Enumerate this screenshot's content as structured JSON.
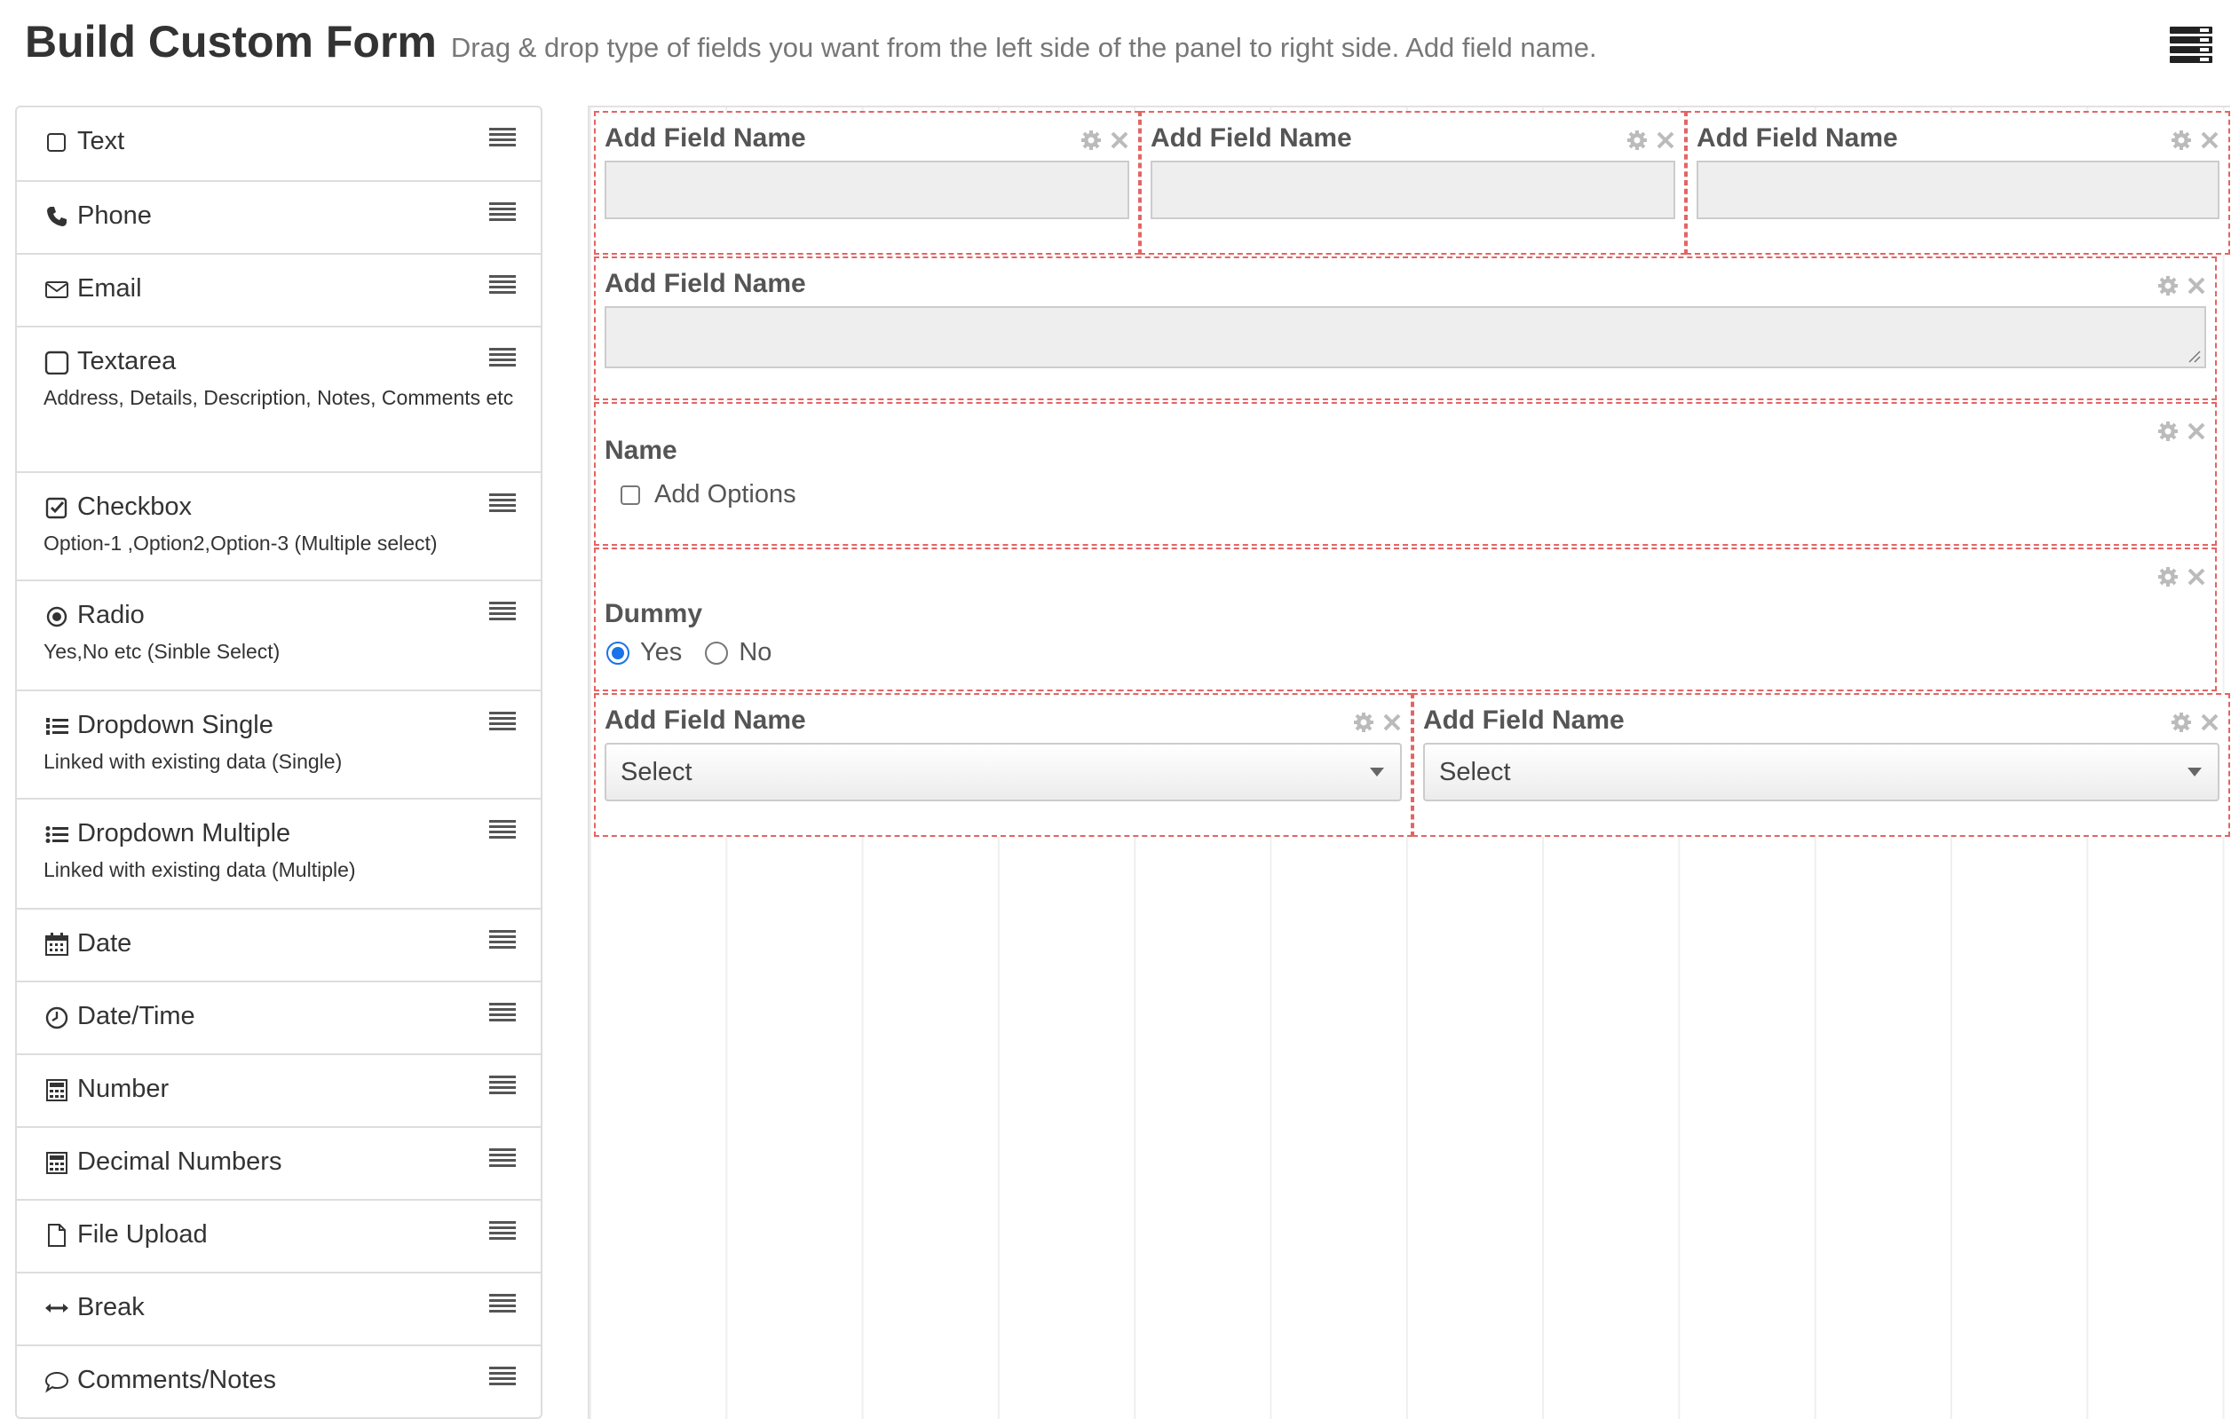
{
  "header": {
    "title": "Build Custom Form",
    "subtitle": "Drag & drop type of fields you want from the left side of the panel to right side. Add field name."
  },
  "palette": {
    "items": [
      {
        "label": "Text",
        "icon": "checkbox-empty-icon",
        "desc": ""
      },
      {
        "label": "Phone",
        "icon": "phone-icon",
        "desc": ""
      },
      {
        "label": "Email",
        "icon": "envelope-icon",
        "desc": ""
      },
      {
        "label": "Textarea",
        "icon": "square-icon",
        "desc": "Address, Details, Description, Notes, Comments etc"
      },
      {
        "label": "Checkbox",
        "icon": "checkbox-checked-icon",
        "desc": "Option-1 ,Option2,Option-3 (Multiple select)"
      },
      {
        "label": "Radio",
        "icon": "radio-icon",
        "desc": "Yes,No etc (Sinble Select)"
      },
      {
        "label": "Dropdown Single",
        "icon": "numbered-list-icon",
        "desc": "Linked with existing data (Single)"
      },
      {
        "label": "Dropdown Multiple",
        "icon": "list-icon",
        "desc": "Linked with existing data (Multiple)"
      },
      {
        "label": "Date",
        "icon": "calendar-icon",
        "desc": ""
      },
      {
        "label": "Date/Time",
        "icon": "clock-icon",
        "desc": ""
      },
      {
        "label": "Number",
        "icon": "calculator-icon",
        "desc": ""
      },
      {
        "label": "Decimal Numbers",
        "icon": "calculator-icon",
        "desc": ""
      },
      {
        "label": "File Upload",
        "icon": "file-icon",
        "desc": ""
      },
      {
        "label": "Break",
        "icon": "horizontal-arrows-icon",
        "desc": ""
      },
      {
        "label": "Comments/Notes",
        "icon": "comment-icon",
        "desc": ""
      }
    ]
  },
  "canvas": {
    "row1": [
      "Add Field Name",
      "Add Field Name",
      "Add Field Name"
    ],
    "textarea_label": "Add Field Name",
    "checkbox_label": "Name",
    "checkbox_option": "Add Options",
    "radio_label": "Dummy",
    "radio_options": [
      "Yes",
      "No"
    ],
    "radio_selected": "Yes",
    "select_fields": [
      {
        "label": "Add Field Name",
        "value": "Select"
      },
      {
        "label": "Add Field Name",
        "value": "Select"
      }
    ]
  },
  "colors": {
    "dashed_border": "#e46464",
    "radio_accent": "#1a73e8"
  }
}
